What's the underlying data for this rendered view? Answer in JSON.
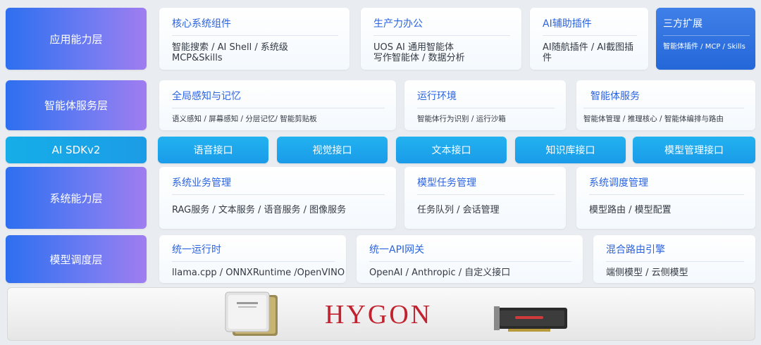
{
  "layers": {
    "app": "应用能力层",
    "agent": "智能体服务层",
    "sdk": "AI SDKv2",
    "system": "系统能力层",
    "model": "模型调度层"
  },
  "app_cards": [
    {
      "title": "核心系统组件",
      "desc": "智能搜索 / AI Shell / 系统级 MCP&Skills"
    },
    {
      "title": "生产力办公",
      "desc": "UOS AI 通用智能体 写作智能体 / 数据分析"
    },
    {
      "title": "AI辅助插件",
      "desc": "AI随航插件 / AI截图插件"
    },
    {
      "title": "三方扩展",
      "desc": "智能体插件 / MCP / Skills"
    }
  ],
  "agent_cards": [
    {
      "title": "全局感知与记忆",
      "desc": "语义感知 / 屏幕感知 / 分层记忆/ 智能剪贴板"
    },
    {
      "title": "运行环境",
      "desc": "智能体行为识别 / 运行沙箱"
    },
    {
      "title": "智能体服务",
      "desc": "智能体管理 / 推理核心 / 智能体编排与路由"
    }
  ],
  "sdk_interfaces": [
    "语音接口",
    "视觉接口",
    "文本接口",
    "知识库接口",
    "模型管理接口"
  ],
  "system_cards": [
    {
      "title": "系统业务管理",
      "desc": "RAG服务 / 文本服务 / 语音服务 / 图像服务"
    },
    {
      "title": "模型任务管理",
      "desc": "任务队列 / 会话管理"
    },
    {
      "title": "系统调度管理",
      "desc": "模型路由 / 模型配置"
    }
  ],
  "model_cards": [
    {
      "title": "统一运行时",
      "desc": "llama.cpp / ONNXRuntime /OpenVINO"
    },
    {
      "title": "统一API网关",
      "desc": "OpenAI / Anthropic / 自定义接口"
    },
    {
      "title": "混合路由引擎",
      "desc": "端侧模型 / 云侧模型"
    }
  ],
  "hardware": {
    "brand": "HYGON",
    "cpu_icon": "cpu-chip-icon",
    "gpu_icon": "gpu-card-icon"
  },
  "colors": {
    "layer_start": "#2d6ff0",
    "layer_end": "#a07df0",
    "sdk": "#1a9be8",
    "title_blue": "#2b63e0",
    "brand_red": "#c0222f"
  }
}
